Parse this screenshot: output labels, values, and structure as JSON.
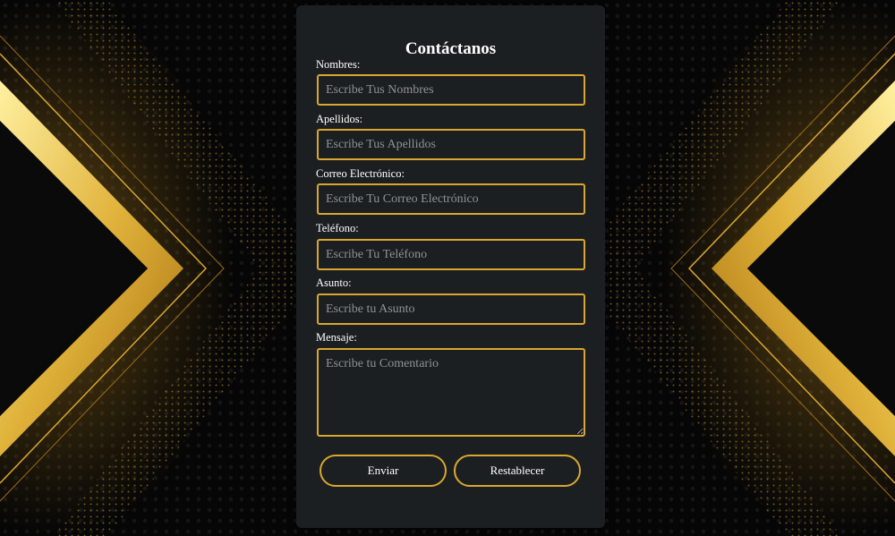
{
  "theme": {
    "accent": "#d9a730",
    "card": "#1c1f22",
    "background": "#050505",
    "placeholder": "#8e9196"
  },
  "form": {
    "title": "Contáctanos",
    "fields": [
      {
        "label": "Nombres:",
        "placeholder": "Escribe Tus Nombres"
      },
      {
        "label": "Apellidos:",
        "placeholder": "Escribe Tus Apellidos"
      },
      {
        "label": "Correo Electrónico:",
        "placeholder": "Escribe Tu Correo Electrónico"
      },
      {
        "label": "Teléfono:",
        "placeholder": "Escribe Tu Teléfono"
      },
      {
        "label": "Asunto:",
        "placeholder": "Escribe tu Asunto"
      },
      {
        "label": "Mensaje:",
        "placeholder": "Escribe tu Comentario"
      }
    ],
    "submit_label": "Enviar",
    "reset_label": "Restablecer"
  }
}
